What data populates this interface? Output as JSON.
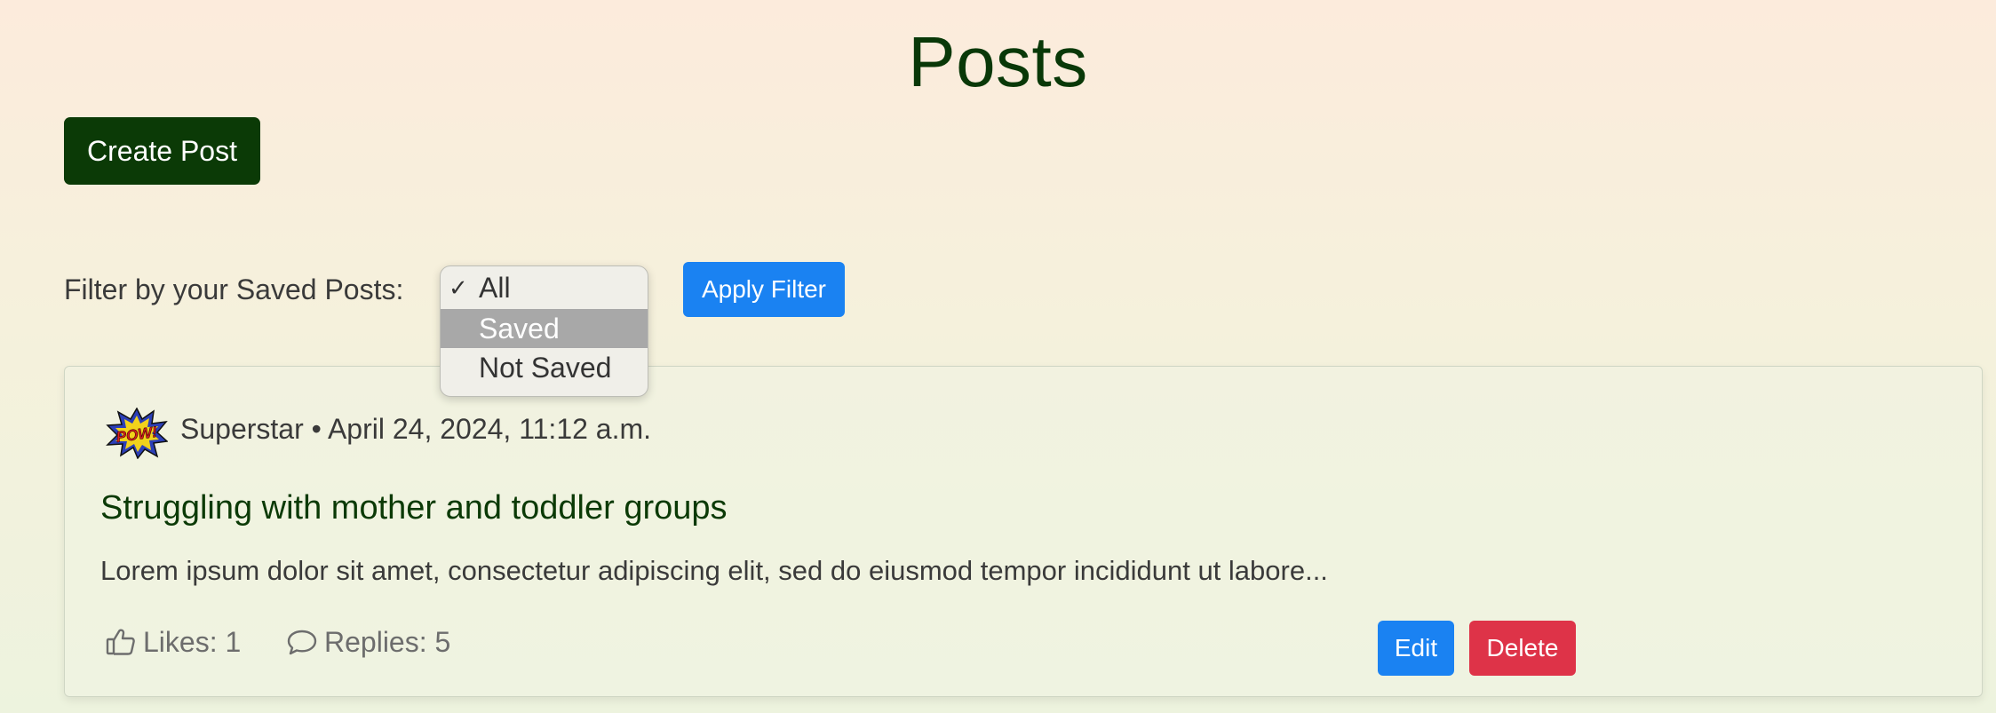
{
  "page": {
    "title": "Posts"
  },
  "toolbar": {
    "create_label": "Create Post"
  },
  "filter": {
    "label": "Filter by your Saved Posts:",
    "options": [
      {
        "label": "All",
        "checked": true
      },
      {
        "label": "Saved",
        "highlighted": true
      },
      {
        "label": "Not Saved"
      }
    ],
    "check_mark": "✓",
    "apply_label": "Apply Filter"
  },
  "post": {
    "avatar_text": "POW!",
    "author": "Superstar",
    "separator": "•",
    "date": "April 24, 2024, 11:12 a.m.",
    "title": "Struggling with mother and toddler groups",
    "excerpt": "Lorem ipsum dolor sit amet, consectetur adipiscing elit, sed do eiusmod tempor incididunt ut labore...",
    "likes_label": "Likes: 1",
    "replies_label": "Replies: 5",
    "edit_label": "Edit",
    "delete_label": "Delete"
  },
  "colors": {
    "brand": "#0b3a06",
    "primary": "#1a82f2",
    "danger": "#de3348"
  },
  "icons": {
    "like": "thumbs-up-icon",
    "reply": "speech-bubble-icon"
  }
}
